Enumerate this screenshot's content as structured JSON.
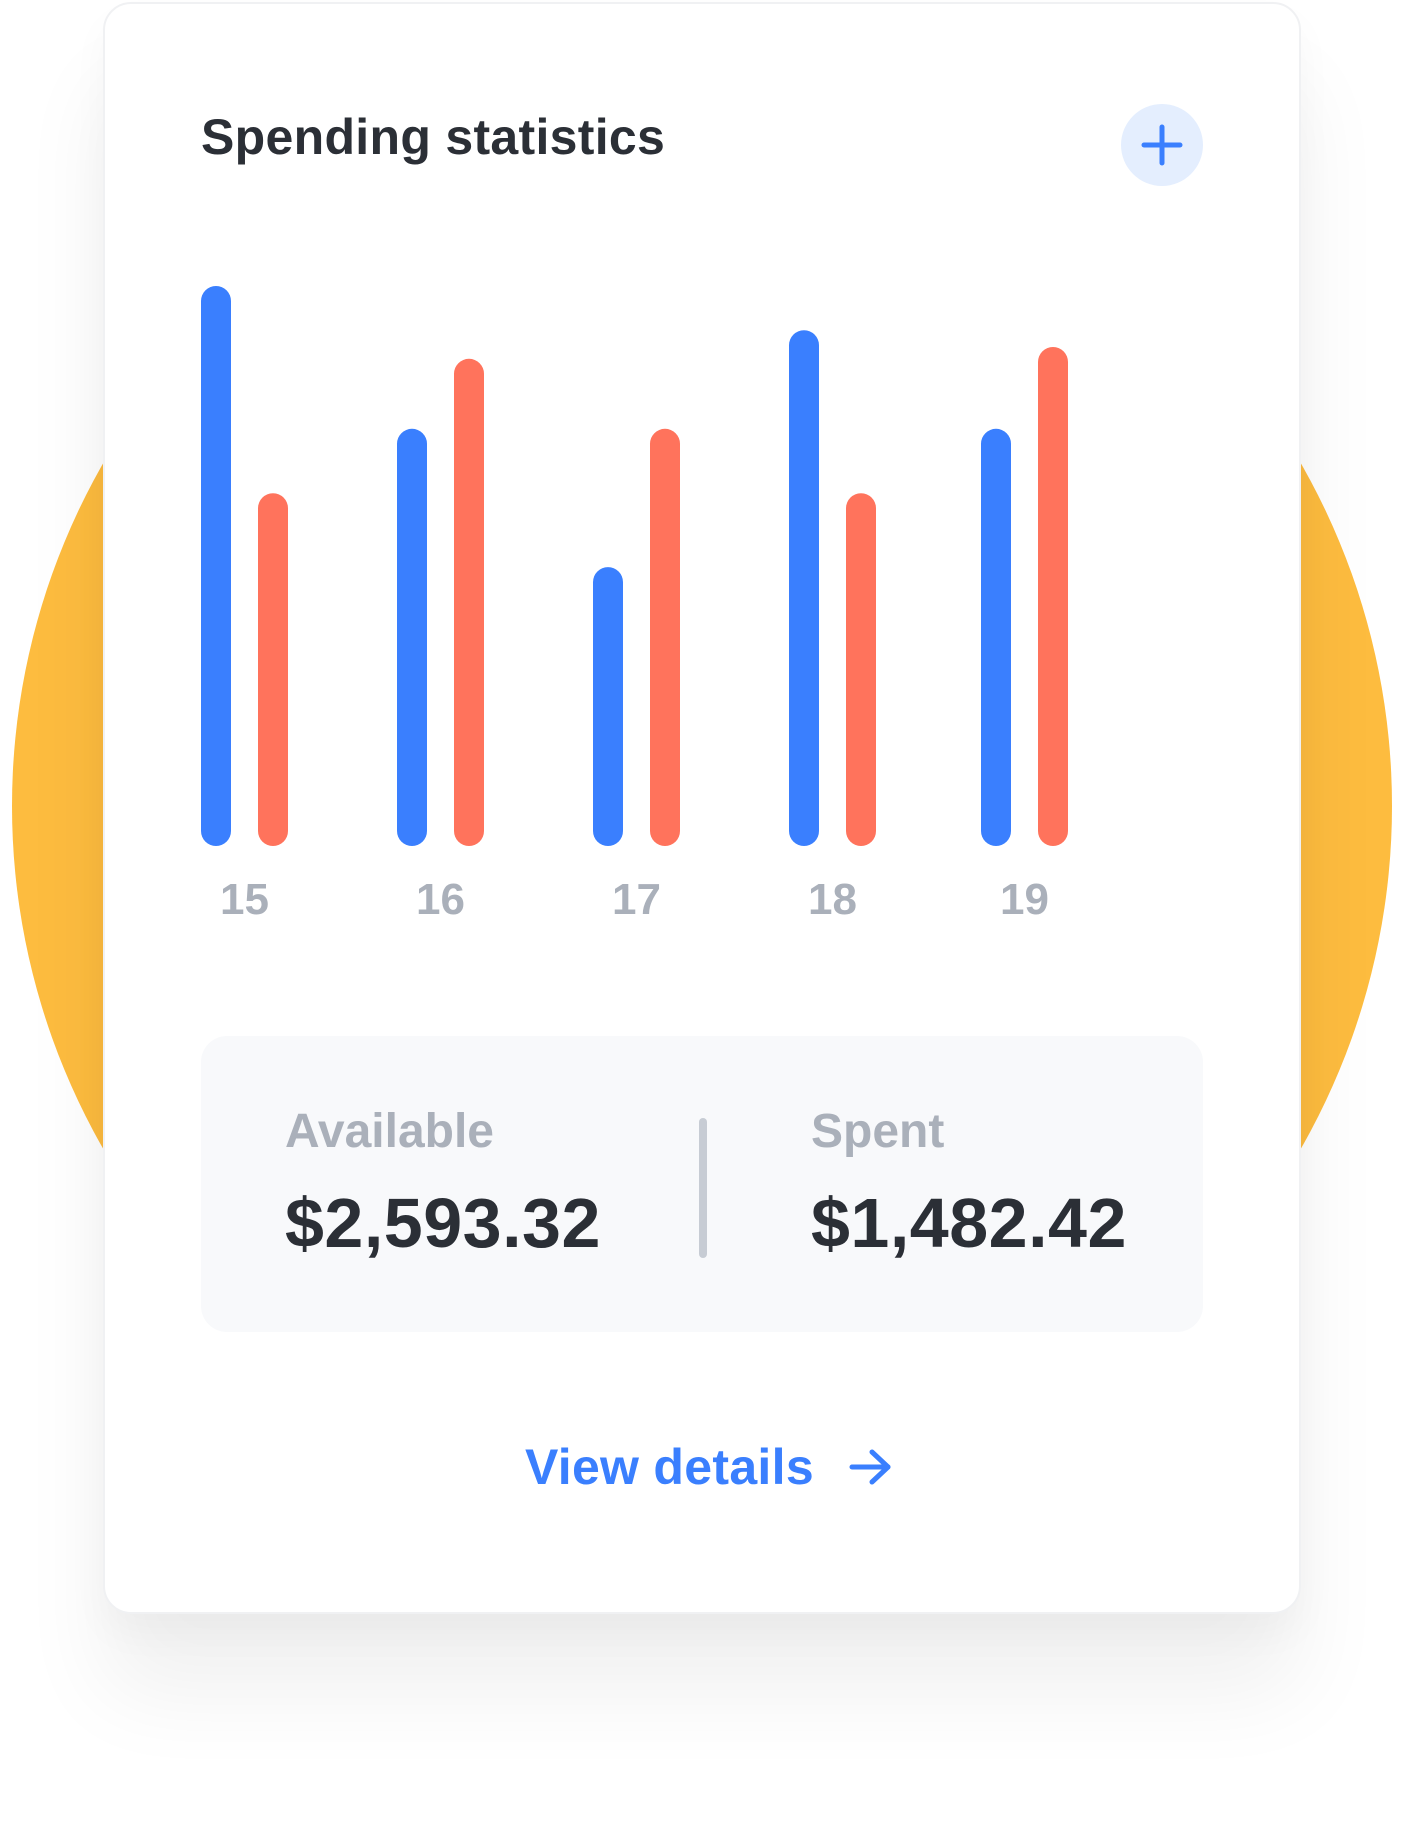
{
  "colors": {
    "backdrop": "#fdbc3f",
    "accent": "#3a7ffe",
    "accent_soft": "#e4eefe",
    "series_a": "#3a7ffe",
    "series_b": "#ff735c",
    "tick_label": "#aab0ba"
  },
  "card": {
    "title": "Spending statistics",
    "add_button_icon": "plus-icon"
  },
  "chart_data": {
    "type": "bar",
    "categories": [
      "15",
      "16",
      "17",
      "18",
      "19"
    ],
    "series": [
      {
        "values": [
          100,
          74.5,
          49.8,
          92.1,
          74.5
        ],
        "color": "#3a7ffe"
      },
      {
        "values": [
          63,
          87,
          74.5,
          63,
          89.1
        ],
        "color": "#ff735c"
      }
    ],
    "ylim": [
      0,
      100
    ],
    "grid": false,
    "legend": "none"
  },
  "summary": {
    "available_label": "Available",
    "available_value": "$2,593.32",
    "spent_label": "Spent",
    "spent_value": "$1,482.42"
  },
  "footer": {
    "view_details_label": "View details",
    "view_details_icon": "arrow-right-icon"
  }
}
